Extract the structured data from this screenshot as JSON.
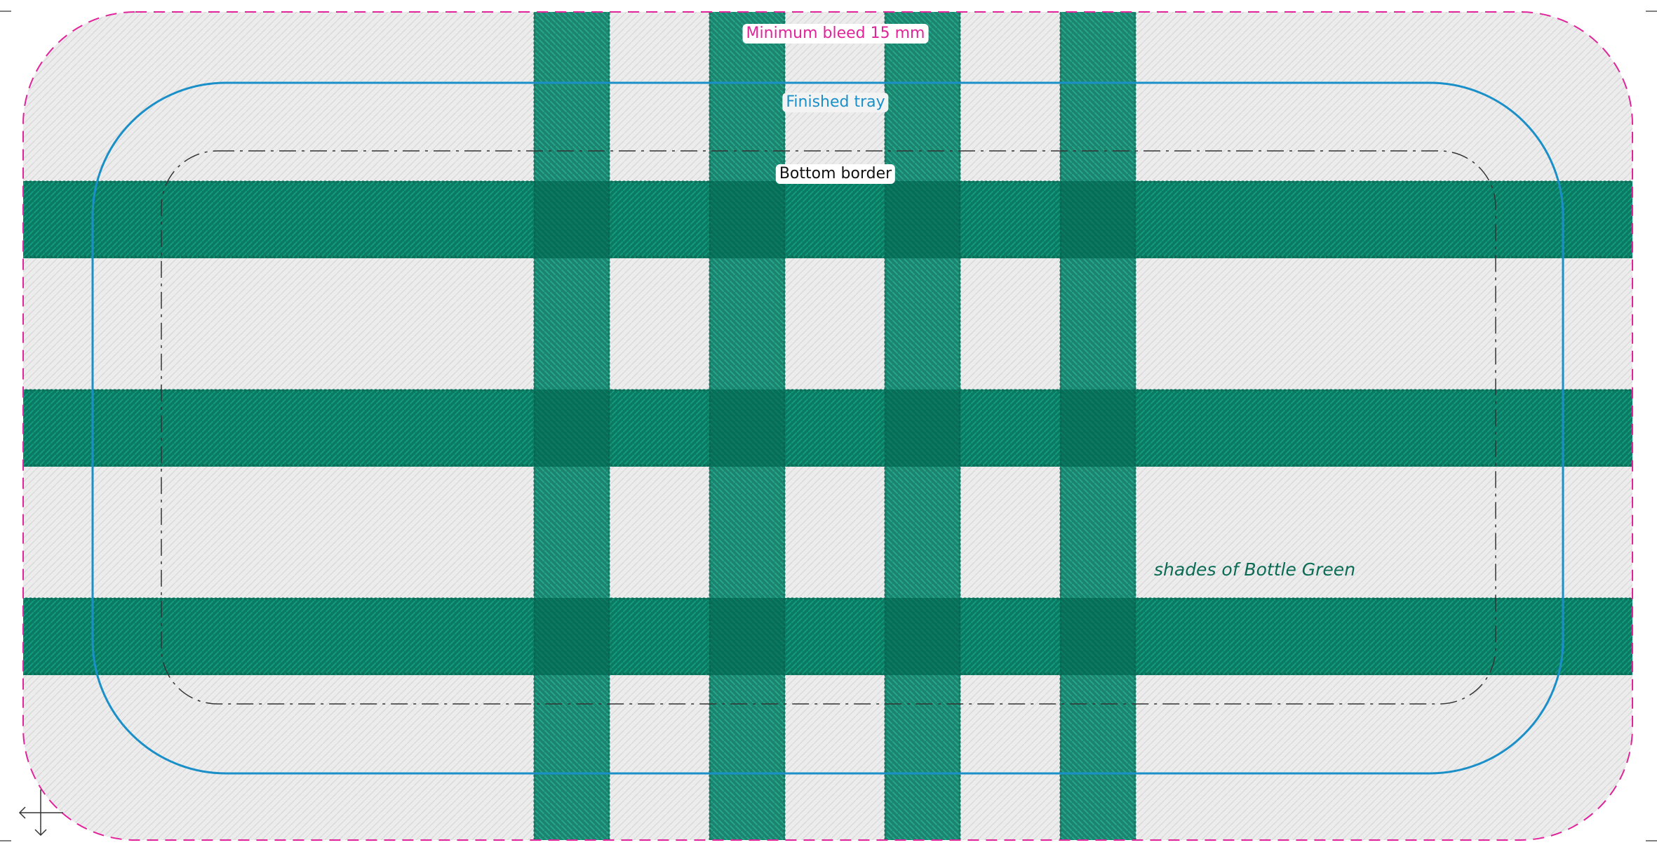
{
  "labels": {
    "minimum_bleed": "Minimum bleed 15 mm",
    "finished_tray": "Finished tray",
    "bottom_border": "Bottom border",
    "fabric_note": "shades of Bottle Green"
  },
  "colors": {
    "bleed_line": "#e0249a",
    "tray_line": "#1a8fc8",
    "border_line": "#333333",
    "stripe_green": "#087e66",
    "stripe_dark": "#05604c",
    "fabric_light": "#ececec",
    "fabric_note_text": "#0b6b55"
  },
  "icons": {
    "orientation_marker": "crosshair-arrow-icon"
  }
}
